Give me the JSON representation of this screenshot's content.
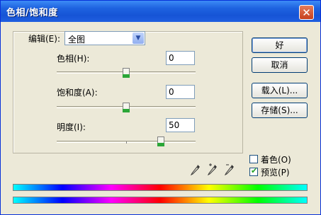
{
  "window": {
    "title": "色相/饱和度",
    "close_glyph": "✕"
  },
  "edit": {
    "label": "编辑(E):",
    "selected": "全图",
    "arrow": "▼"
  },
  "hue": {
    "label": "色相(H):",
    "value": "0",
    "slider_fraction": 0.5
  },
  "saturation": {
    "label": "饱和度(A):",
    "value": "0",
    "slider_fraction": 0.5
  },
  "lightness": {
    "label": "明度(I):",
    "value": "50",
    "slider_fraction": 0.75
  },
  "buttons": {
    "ok": "好",
    "cancel": "取消",
    "load": "载入(L)...",
    "save": "存储(S)..."
  },
  "colorize": {
    "label": "着色(O)",
    "checked": false
  },
  "preview": {
    "label": "预览(P)",
    "checked": true,
    "mark": "✔"
  },
  "colors": {
    "title_bar": "#1654d6",
    "close": "#c7401e",
    "thumb": "#2aa637"
  }
}
